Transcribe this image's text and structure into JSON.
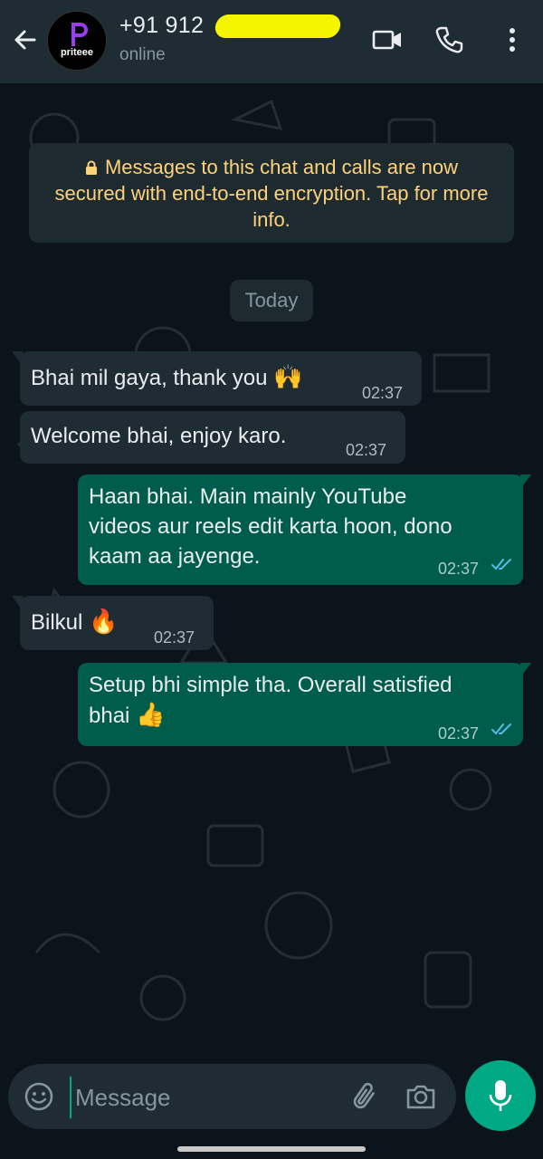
{
  "header": {
    "avatar_text": "priteee",
    "contact_name": "+91 912",
    "status": "online"
  },
  "encryption_notice": "Messages to this chat and calls are now secured with end-to-end encryption. Tap for more info.",
  "date_chip": "Today",
  "messages": [
    {
      "direction": "in",
      "text": "Bhai mil gaya, thank you",
      "emoji": "🙌",
      "time": "02:37"
    },
    {
      "direction": "in",
      "text": "Welcome bhai, enjoy karo.",
      "time": "02:37"
    },
    {
      "direction": "out",
      "lines": [
        "Haan bhai. Main mainly YouTube",
        "videos aur reels edit karta hoon, dono",
        "kaam aa jayenge."
      ],
      "time": "02:37",
      "status": "read"
    },
    {
      "direction": "in",
      "text": "Bilkul",
      "emoji": "🔥",
      "time": "02:37"
    },
    {
      "direction": "out",
      "lines": [
        "Setup bhi simple tha. Overall satisfied",
        "bhai"
      ],
      "emoji": "👍",
      "time": "02:37",
      "status": "read"
    }
  ],
  "composer": {
    "placeholder": "Message"
  },
  "icons": {
    "back": "arrow-left-icon",
    "video": "video-camera-icon",
    "call": "phone-icon",
    "menu": "more-vertical-icon",
    "emoji": "smiley-icon",
    "attach": "paperclip-icon",
    "camera": "camera-icon",
    "mic": "microphone-icon",
    "read": "double-check-icon"
  },
  "colors": {
    "header_bg": "#1f2c34",
    "chat_bg": "#0b141a",
    "incoming_bubble": "#1f2c33",
    "outgoing_bubble": "#005c4b",
    "accent": "#00a884",
    "read_ticks": "#53bdeb",
    "encryption_text": "#ffd279"
  }
}
